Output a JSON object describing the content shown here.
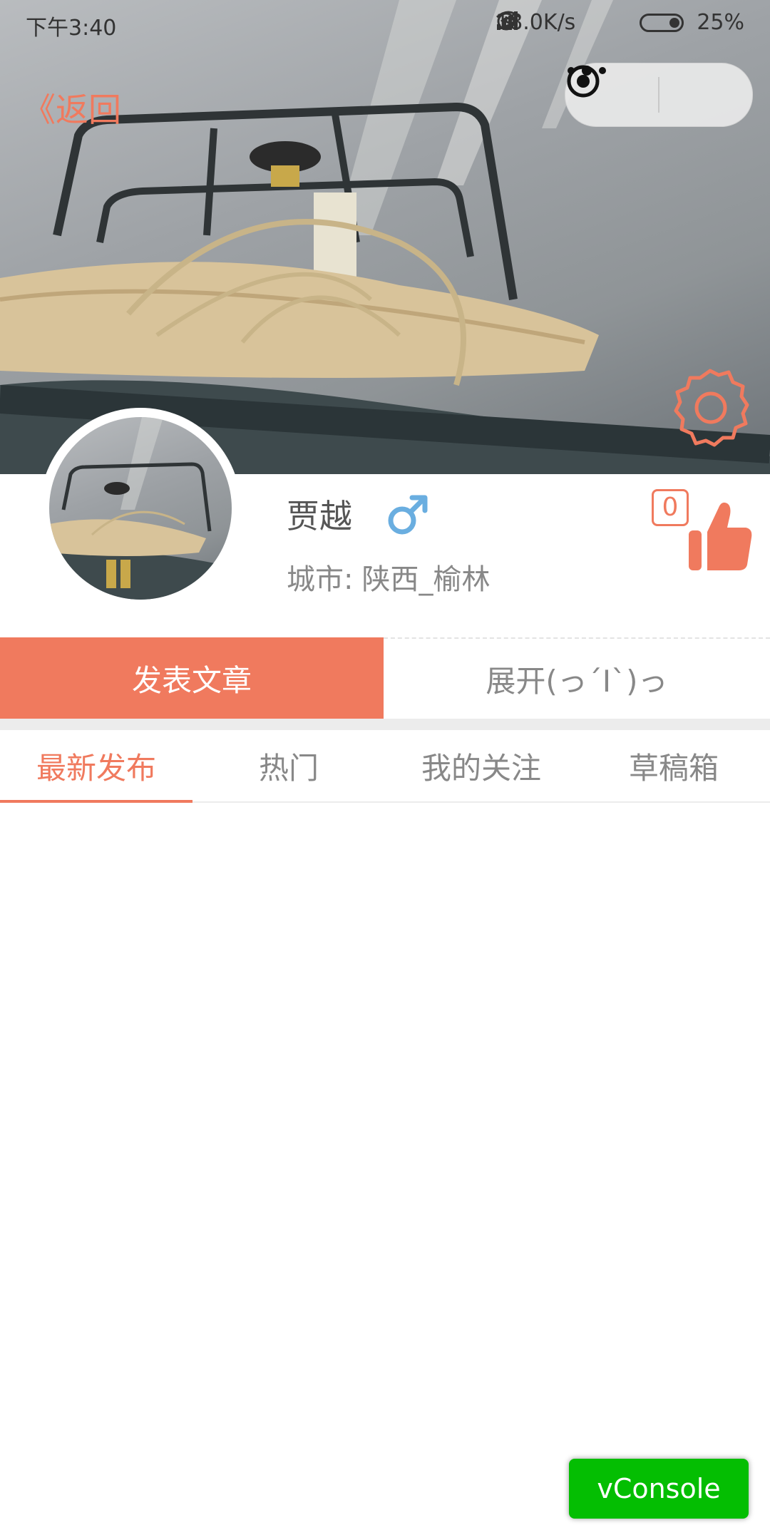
{
  "status_bar": {
    "time": "下午3:40",
    "network_speed": "18.0K/s",
    "battery": "25%",
    "icons": [
      "alarm-icon",
      "wifi-icon",
      "signal-icon",
      "signal-icon",
      "battery-icon"
    ]
  },
  "nav": {
    "back_label": "《返回",
    "capsule_icons": [
      "more-icon",
      "close-target-icon"
    ]
  },
  "profile": {
    "name": "贾越",
    "gender_icon": "male-icon",
    "city_label": "城市:",
    "city_value": "陕西_榆林",
    "like_count": "0",
    "like_icon": "thumbs-up-icon",
    "settings_icon": "gear-icon"
  },
  "actions": {
    "publish_label": "发表文章",
    "expand_label": "展开(っ´Ι`)っ"
  },
  "tabs": [
    {
      "label": "最新发布",
      "active": true
    },
    {
      "label": "热门",
      "active": false
    },
    {
      "label": "我的关注",
      "active": false
    },
    {
      "label": "草稿箱",
      "active": false
    }
  ],
  "vconsole_label": "vConsole",
  "colors": {
    "accent": "#f07a5e",
    "male": "#6aaee0",
    "vconsole": "#04be02"
  }
}
